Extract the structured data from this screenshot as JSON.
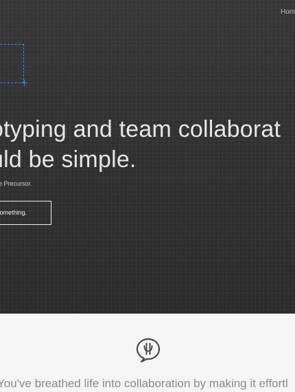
{
  "nav": {
    "home_label": "Home"
  },
  "hero": {
    "headline_line1": "otyping and team collaborat",
    "headline_line2": "uld be simple.",
    "credit": "ade Precursor.",
    "cta_label": "omething."
  },
  "testimonial": {
    "icon": "speech-bubble-icon",
    "quote": "You've breathed life into collaboration by making it effortl"
  },
  "colors": {
    "hero_background": "#2f2f2f",
    "selection_accent": "#4a90c8",
    "lower_background": "#f5f5f5",
    "testimonial_text": "#8a8a8a"
  }
}
